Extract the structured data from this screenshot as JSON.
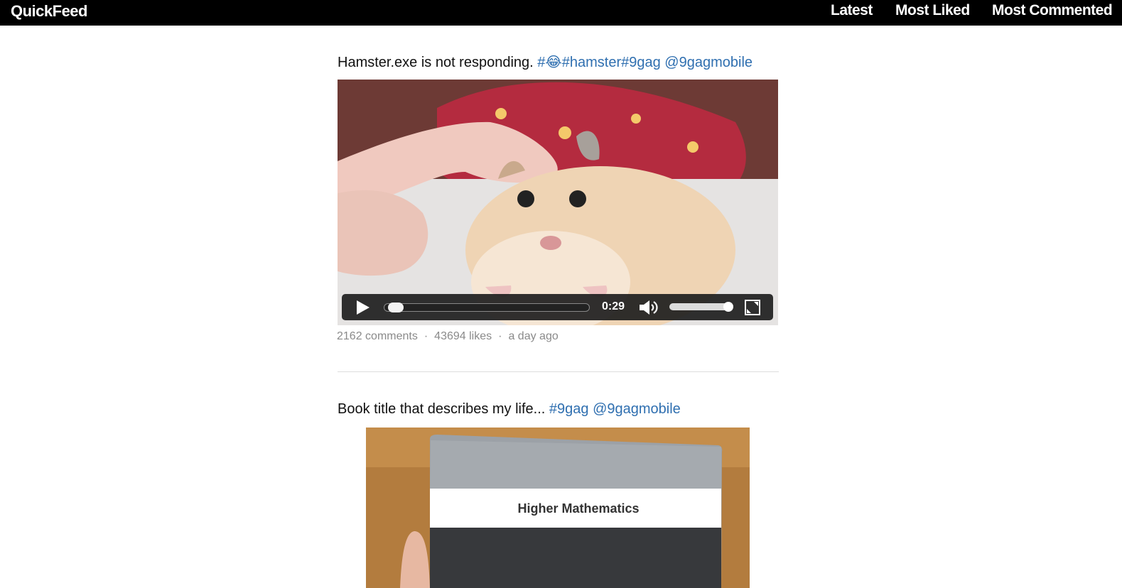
{
  "app": {
    "brand": "QuickFeed"
  },
  "nav": {
    "latest": "Latest",
    "most_liked": "Most Liked",
    "most_commented": "Most Commented"
  },
  "posts": [
    {
      "title": "Hamster.exe is not responding.",
      "tags": "#😂#hamster#9gag @9gagmobile",
      "media_type": "video",
      "video": {
        "time": "0:29",
        "progress": 0.02,
        "volume": 1.0
      },
      "comments": "2162 comments",
      "likes": "43694 likes",
      "age": "a day ago"
    },
    {
      "title": "Book title that describes my life...",
      "tags": "#9gag @9gagmobile",
      "media_type": "image",
      "book_title": "Higher Mathematics"
    }
  ],
  "meta_separator": "·",
  "colors": {
    "topbar": "#000000",
    "link": "#2f6fb0",
    "meta_text": "#8a8a8a"
  }
}
